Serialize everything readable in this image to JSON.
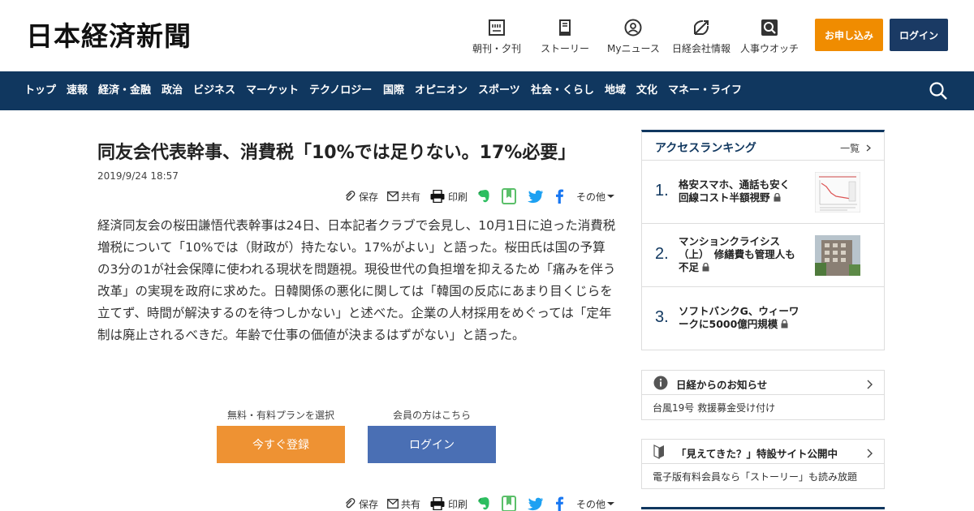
{
  "header": {
    "logo": "日本経済新聞",
    "nav": [
      {
        "label": "朝刊・夕刊",
        "icon": "newspaper-icon"
      },
      {
        "label": "ストーリー",
        "icon": "book-icon"
      },
      {
        "label": "Myニュース",
        "icon": "user-icon"
      },
      {
        "label": "日経会社情報",
        "icon": "chart-icon"
      },
      {
        "label": "人事ウオッチ",
        "icon": "person-search-icon"
      }
    ],
    "apply_label": "お申し込み",
    "login_label": "ログイン"
  },
  "navbar": {
    "items": [
      "トップ",
      "速報",
      "経済・金融",
      "政治",
      "ビジネス",
      "マーケット",
      "テクノロジー",
      "国際",
      "オピニオン",
      "スポーツ",
      "社会・くらし",
      "地域",
      "文化",
      "マネー・ライフ"
    ],
    "search_icon": "search-icon"
  },
  "article": {
    "title": "同友会代表幹事、消費税「10%では足りない。17%必要」",
    "date": "2019/9/24 18:57",
    "share": {
      "save": "保存",
      "share": "共有",
      "print": "印刷",
      "more": "その他"
    },
    "body": "経済同友会の桜田謙悟代表幹事は24日、日本記者クラブで会見し、10月1日に迫った消費税増税について「10%では（財政が）持たない。17%がよい」と語った。桜田氏は国の予算の3分の1が社会保障に使われる現状を問題視。現役世代の負担増を抑えるため「痛みを伴う改革」の実現を政府に求めた。日韓関係の悪化に関しては「韓国の反応にあまり目くじらを立てず、時間が解決するのを待つしかない」と述べた。企業の人材採用をめぐっては「定年制は廃止されるべきだ。年齢で仕事の価値が決まるはずがない」と語った。",
    "cta": {
      "plan_label": "無料・有料プランを選択",
      "register_button": "今すぐ登録",
      "member_label": "会員の方はこちら",
      "login_button": "ログイン"
    }
  },
  "sidebar": {
    "ranking": {
      "title": "アクセスランキング",
      "more": "一覧",
      "items": [
        {
          "rank": "1.",
          "text": "格安スマホ、通話も安く 回線コスト半額視野"
        },
        {
          "rank": "2.",
          "text": "マンションクライシス（上）　修繕費も管理人も不足"
        },
        {
          "rank": "3.",
          "text": "ソフトバンクG、ウィーワークに5000億円規模"
        }
      ]
    },
    "notices": [
      {
        "title": "日経からのお知らせ",
        "sub": "台風19号 救援募金受け付け",
        "icon": "info-icon"
      },
      {
        "title": "「見えてきた？」特設サイト公開中",
        "sub": "電子版有料会員なら「ストーリー」も読み放題",
        "icon": "beginner-mark-icon"
      }
    ]
  },
  "colors": {
    "navy": "#10375f",
    "orange": "#f08c00",
    "register": "#ee9233",
    "login_blue": "#4a6fb4"
  }
}
